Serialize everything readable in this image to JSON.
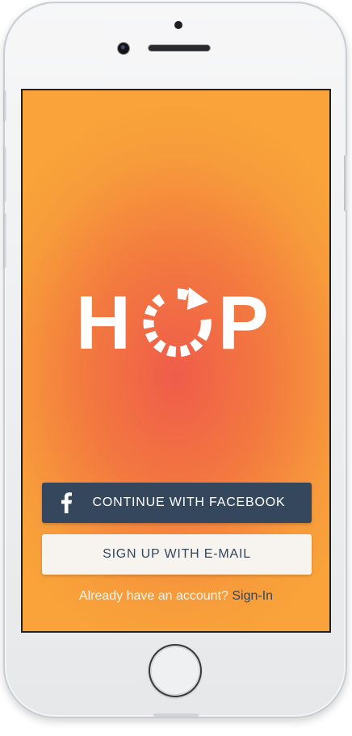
{
  "app": {
    "logo_text": "HOP",
    "logo_letter_left": "H",
    "logo_letter_right": "P"
  },
  "buttons": {
    "facebook_label": "CONTINUE WITH FACEBOOK",
    "email_label": "SIGN UP WITH E-MAIL"
  },
  "signin": {
    "prompt": "Already have an account?",
    "link_label": "Sign-In"
  },
  "icons": {
    "facebook": "facebook-icon",
    "logo_o": "refresh-circle-icon"
  },
  "colors": {
    "gradient_center": "#ef5c4a",
    "gradient_edge": "#f9a33a",
    "facebook_button": "#34475d",
    "email_button": "#f7f4ef",
    "link": "#34475d"
  }
}
